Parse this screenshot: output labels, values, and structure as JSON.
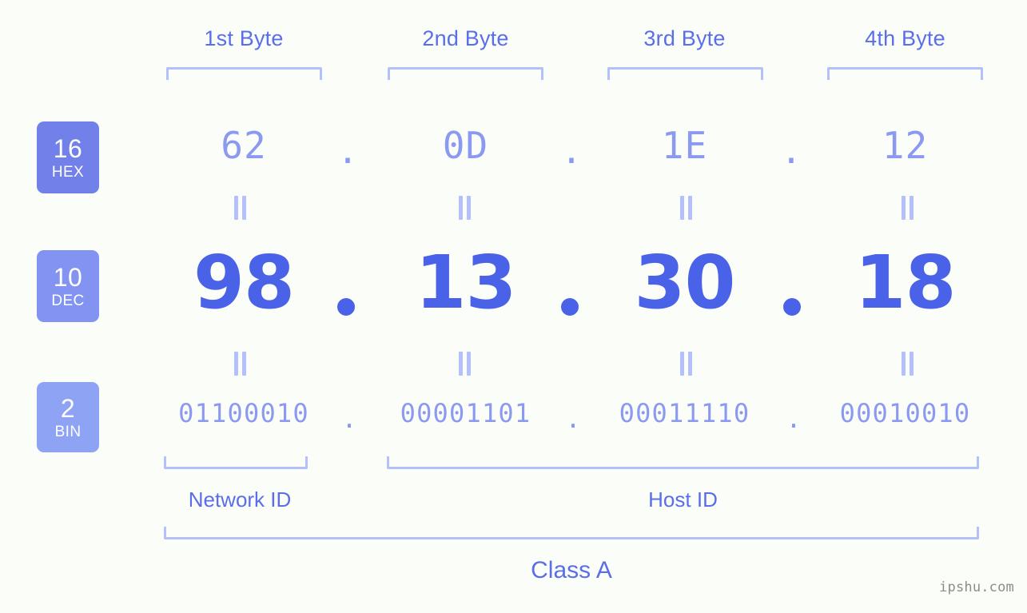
{
  "headers": [
    {
      "label": "1st Byte"
    },
    {
      "label": "2nd Byte"
    },
    {
      "label": "3rd Byte"
    },
    {
      "label": "4th Byte"
    }
  ],
  "rows": {
    "hex": {
      "base": "16",
      "abbr": "HEX",
      "separator": ".",
      "values": [
        "62",
        "0D",
        "1E",
        "12"
      ]
    },
    "dec": {
      "base": "10",
      "abbr": "DEC",
      "separator": ".",
      "values": [
        "98",
        "13",
        "30",
        "18"
      ]
    },
    "bin": {
      "base": "2",
      "abbr": "BIN",
      "separator": ".",
      "values": [
        "01100010",
        "00001101",
        "00011110",
        "00010010"
      ]
    }
  },
  "connector": "=",
  "sections": {
    "network_id": "Network ID",
    "host_id": "Host ID",
    "class": "Class A"
  },
  "watermark": "ipshu.com",
  "colors": {
    "background": "#fbfdf8",
    "badge_hex": "#7181e9",
    "badge_dec": "#8393f2",
    "badge_bin": "#8fa3f5",
    "text_header": "#5a6ee8",
    "text_dec": "#4a62e8",
    "text_light": "#8b9af0",
    "bracket": "#b4c0fb",
    "watermark": "#8c8c8c"
  }
}
